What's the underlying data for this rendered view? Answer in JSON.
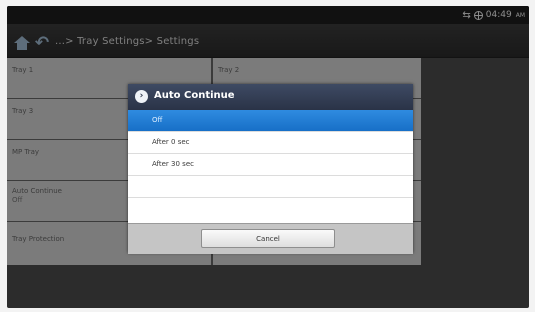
{
  "status": {
    "time": "04:49",
    "ampm": "AM"
  },
  "header": {
    "breadcrumb": "...> Tray Settings> Settings"
  },
  "settings": {
    "tray1": "Tray 1",
    "tray2": "Tray 2",
    "tray3": "Tray 3",
    "mp_tray": "MP Tray",
    "auto_continue_label": "Auto Continue",
    "auto_continue_value": "Off",
    "tray_protection": "Tray Protection"
  },
  "dialog": {
    "title": "Auto Continue",
    "options": [
      "Off",
      "After 0 sec",
      "After 30 sec"
    ],
    "selected_index": 0,
    "cancel_label": "Cancel"
  },
  "colors": {
    "selected": "#1e7ad4",
    "dialog_header": "#323b52"
  }
}
